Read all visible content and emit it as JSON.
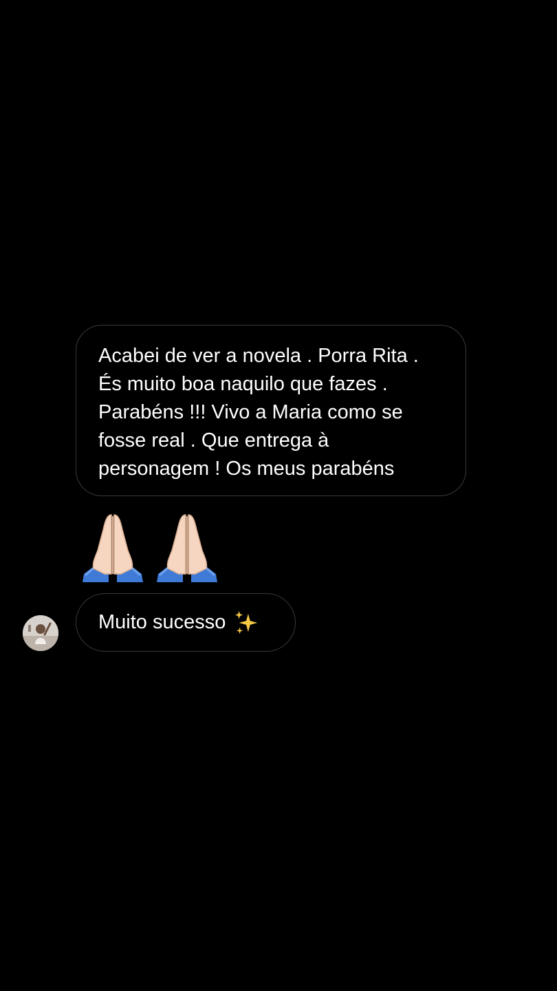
{
  "thread": {
    "message_1": {
      "lines": [
        "Acabei de ver a novela . Porra Rita .",
        "És muito boa naquilo que fazes .",
        "Parabéns  !!! Vivo a Maria como se",
        "fosse real . Que entrega à",
        "personagem ! Os meus parabéns"
      ]
    },
    "message_2": {
      "icons": [
        "folded-hands-icon",
        "folded-hands-icon"
      ]
    },
    "message_3": {
      "text": "Muito sucesso",
      "icon": "sparkles-icon"
    },
    "sender_avatar": "avatar"
  },
  "colors": {
    "background": "#000000",
    "bubble_border": "#3a3a3c",
    "text": "#ffffff",
    "sleeve": "#3f7bd6",
    "skin": "#f6d6c0",
    "sparkle": "#f6c945"
  }
}
